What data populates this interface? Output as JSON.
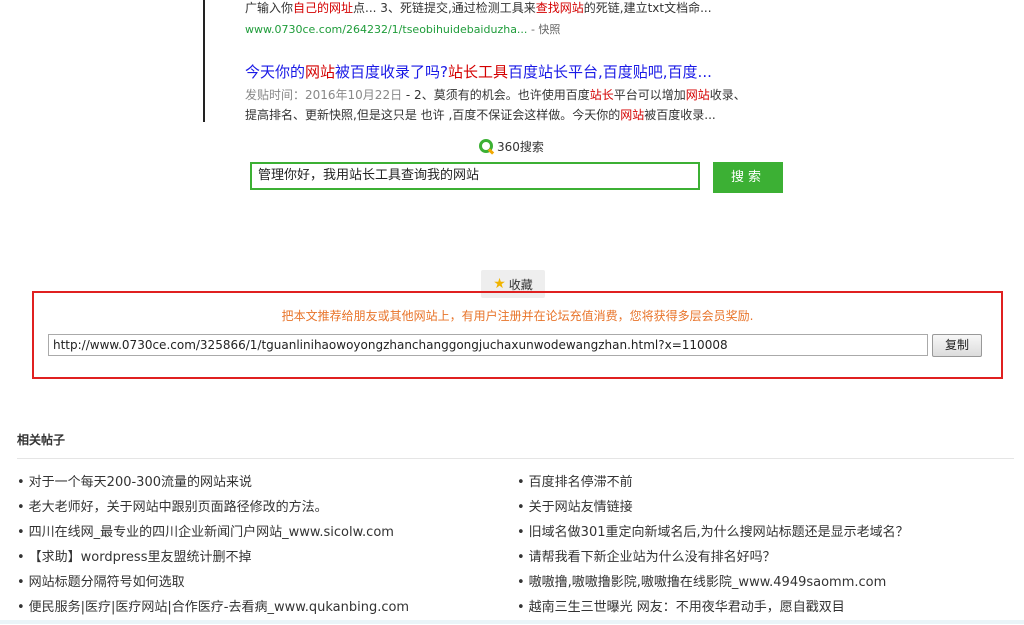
{
  "results": {
    "r1_snippet": [
      "广输入你",
      "自己的",
      "网址",
      "点... 3、死链提交,通过检测工具来",
      "查找网站",
      "的死链,建立txt文档命..."
    ],
    "r1_url": "www.0730ce.com/264232/1/tseobihuidebaiduzha...",
    "r1_snapshot": "- 快照",
    "r2_title": [
      "今天你的",
      "网站",
      "被百度收录了吗?",
      "站长工具",
      "百度站长平台,百度贴吧,百度..."
    ],
    "r2_date": "发贴时间：2016年10月22日",
    "r2_line1": [
      " - 2、莫须有的机会。也许使用百度",
      "站长",
      "平台可以增加",
      "网站",
      "收录、"
    ],
    "r2_line2": [
      "提高排名、更新快照,但是这只是 也许 ,百度不保证会这样做。今天你的",
      "网站",
      "被百度收录..."
    ]
  },
  "search": {
    "logo_text": "360搜索",
    "query": "管理你好，我用站长工具查询我的网站",
    "button_label": "搜索"
  },
  "favorite": {
    "label": "收藏"
  },
  "share": {
    "tip": "把本文推荐给朋友或其他网站上，有用户注册并在论坛充值消费，您将获得多层会员奖励.",
    "url": "http://www.0730ce.com/325866/1/tguanlinihaowoyongzhanchanggongjuchaxunwodewangzhan.html?x=110008",
    "copy_label": "复制"
  },
  "related": {
    "title": "相关帖子",
    "left": [
      "对于一个每天200-300流量的网站来说",
      "老大老师好，关于网站中跟别页面路径修改的方法。",
      "四川在线网_最专业的四川企业新闻门户网站_www.sicolw.com",
      "【求助】wordpress里友盟统计删不掉",
      "网站标题分隔符号如何选取",
      "便民服务|医疗|医疗网站|合作医疗-去看病_www.qukanbing.com"
    ],
    "right": [
      "百度排名停滞不前",
      "关于网站友情链接",
      "旧域名做301重定向新域名后,为什么搜网站标题还是显示老域名？",
      "请帮我看下新企业站为什么没有排名好吗？",
      "嗷嗷撸,嗷嗷撸影院,嗷嗷撸在线影院_www.4949saomm.com",
      "越南三生三世曝光 网友：不用夜华君动手，愿自戳双目"
    ]
  }
}
